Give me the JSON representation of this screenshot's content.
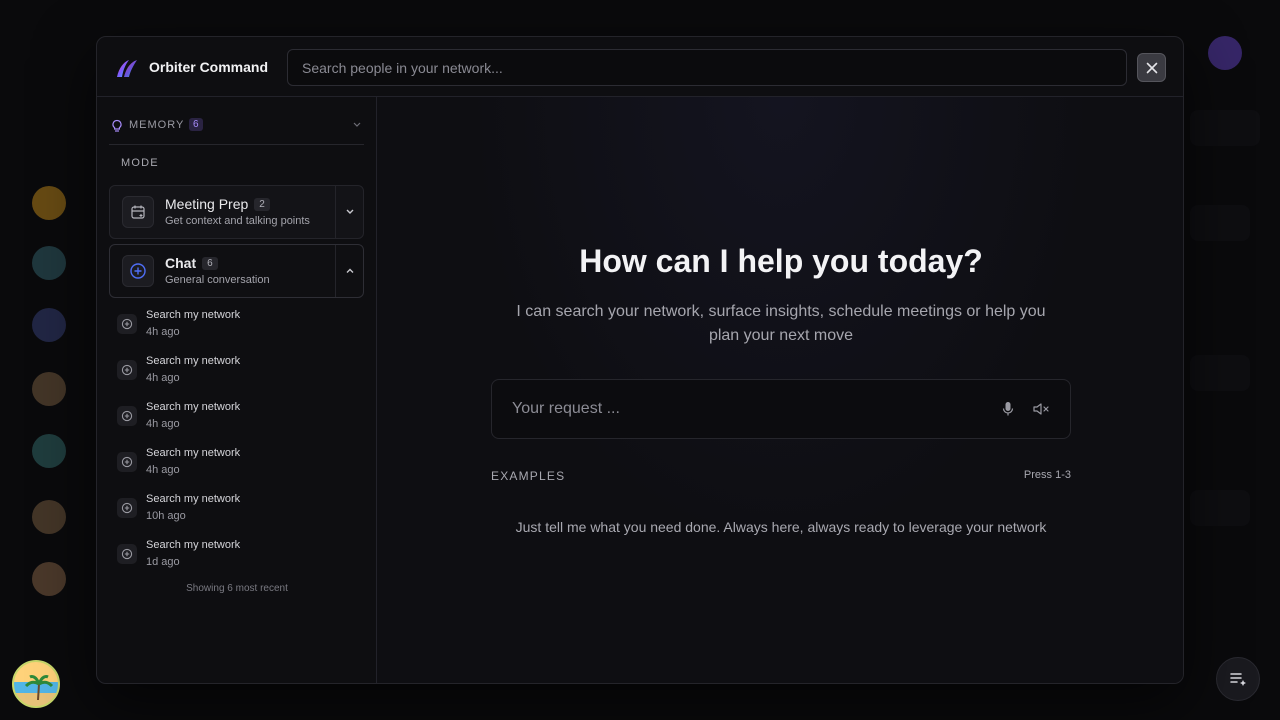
{
  "header": {
    "app_title": "Orbiter Command",
    "search_placeholder": "Search people in your network..."
  },
  "sidebar": {
    "memory": {
      "label": "MEMORY",
      "count": "6"
    },
    "mode_label": "MODE",
    "modes": [
      {
        "title": "Meeting Prep",
        "count": "2",
        "description": "Get context and talking points",
        "icon": "calendar-icon",
        "expanded": false
      },
      {
        "title": "Chat",
        "count": "6",
        "description": "General conversation",
        "icon": "plus-circle-icon",
        "expanded": true
      }
    ],
    "history": [
      {
        "title": "Search my network",
        "time": "4h ago"
      },
      {
        "title": "Search my network",
        "time": "4h ago"
      },
      {
        "title": "Search my network",
        "time": "4h ago"
      },
      {
        "title": "Search my network",
        "time": "4h ago"
      },
      {
        "title": "Search my network",
        "time": "10h ago"
      },
      {
        "title": "Search my network",
        "time": "1d ago"
      }
    ],
    "history_footer": "Showing 6 most recent"
  },
  "main": {
    "headline": "How can I help you today?",
    "subtitle": "I can search your network, surface insights, schedule meetings or help you plan your next move",
    "request_placeholder": "Your request ...",
    "examples_label": "EXAMPLES",
    "examples_shortcut": "Press 1-3",
    "tagline": "Just tell me what you need done. Always here, always ready to leverage your network"
  },
  "colors": {
    "accent_purple": "#a78bfa",
    "chat_icon_blue": "#4f6ef7",
    "background": "#0e0e11"
  }
}
